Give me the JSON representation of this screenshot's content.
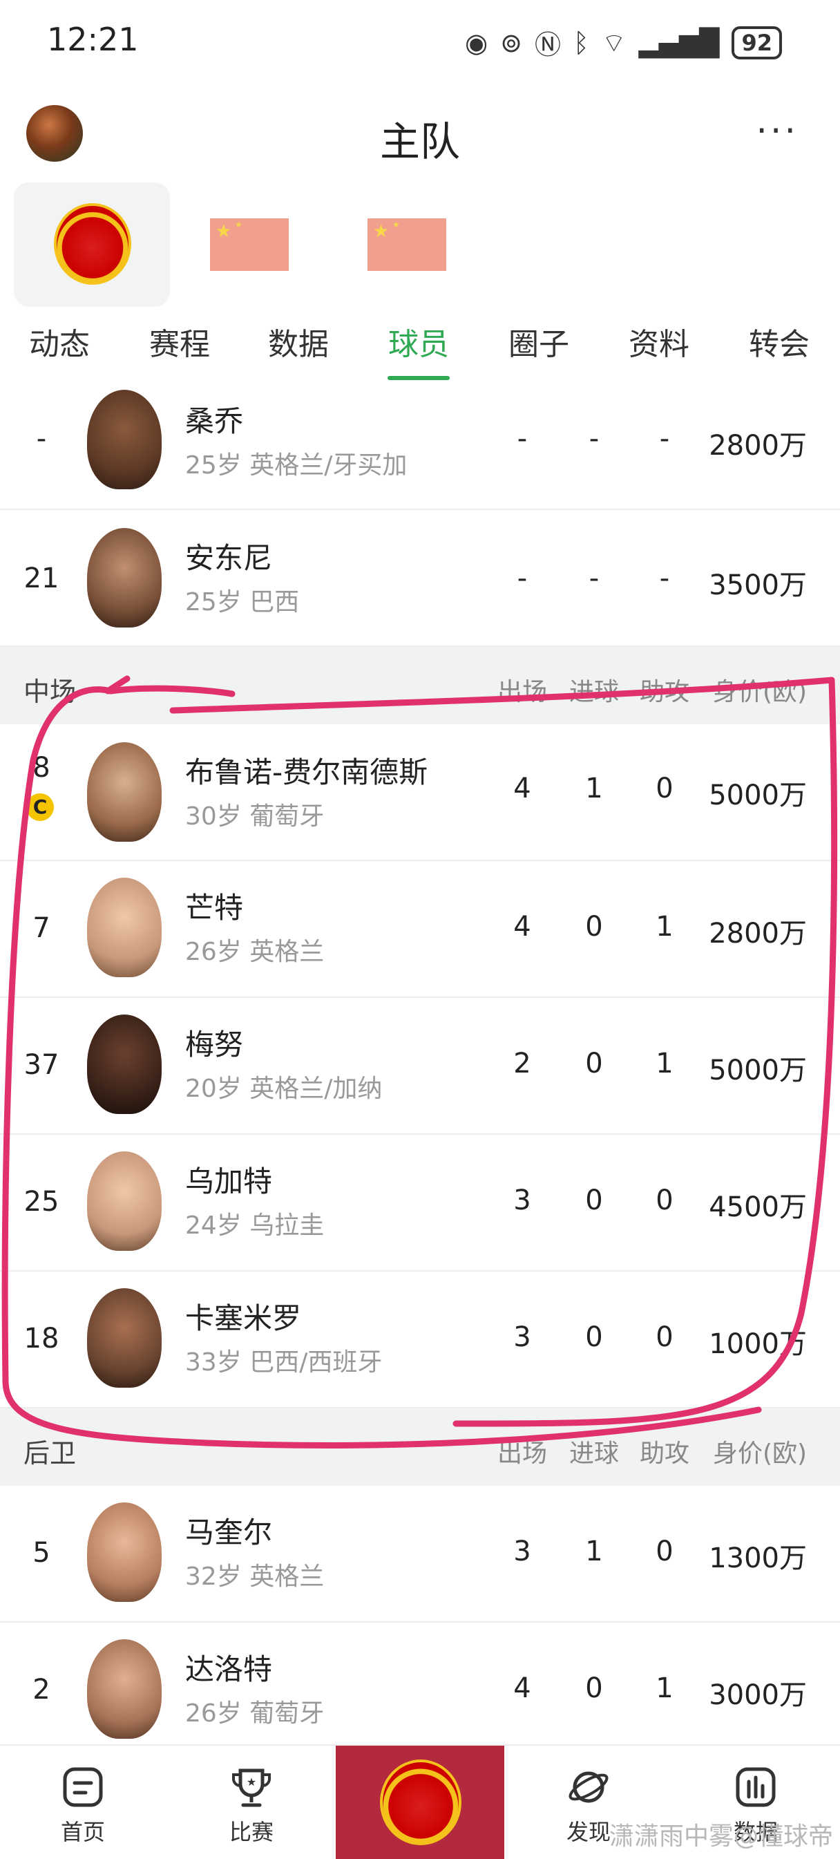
{
  "status": {
    "time": "12:21",
    "battery": "92",
    "icons": [
      "eye-icon",
      "hotspot-icon",
      "nfc-icon",
      "bluetooth-icon",
      "wifi-icon",
      "signal-icon",
      "battery-icon"
    ]
  },
  "header": {
    "title": "主队",
    "more": "···"
  },
  "tabs": [
    "动态",
    "赛程",
    "数据",
    "球员",
    "圈子",
    "资料",
    "转会"
  ],
  "active_tab": "球员",
  "colors": {
    "accent": "#2faa52",
    "brand": "#b32a3f",
    "highlight": "#e0306e"
  },
  "players_top": [
    {
      "num": "-",
      "name": "桑乔",
      "info": "25岁 英格兰/牙买加",
      "apps": "-",
      "goals": "-",
      "assists": "-",
      "value": "2800万"
    },
    {
      "num": "21",
      "name": "安东尼",
      "info": "25岁 巴西",
      "apps": "-",
      "goals": "-",
      "assists": "-",
      "value": "3500万"
    }
  ],
  "midfield": {
    "title": "中场",
    "columns": [
      "出场",
      "进球",
      "助攻",
      "身价(欧)"
    ],
    "players": [
      {
        "num": "8",
        "captain": "C",
        "name": "布鲁诺-费尔南德斯",
        "info": "30岁 葡萄牙",
        "apps": "4",
        "goals": "1",
        "assists": "0",
        "value": "5000万"
      },
      {
        "num": "7",
        "name": "芒特",
        "info": "26岁 英格兰",
        "apps": "4",
        "goals": "0",
        "assists": "1",
        "value": "2800万"
      },
      {
        "num": "37",
        "name": "梅努",
        "info": "20岁 英格兰/加纳",
        "apps": "2",
        "goals": "0",
        "assists": "1",
        "value": "5000万"
      },
      {
        "num": "25",
        "name": "乌加特",
        "info": "24岁 乌拉圭",
        "apps": "3",
        "goals": "0",
        "assists": "0",
        "value": "4500万"
      },
      {
        "num": "18",
        "name": "卡塞米罗",
        "info": "33岁 巴西/西班牙",
        "apps": "3",
        "goals": "0",
        "assists": "0",
        "value": "1000万"
      }
    ]
  },
  "defense": {
    "title": "后卫",
    "columns": [
      "出场",
      "进球",
      "助攻",
      "身价(欧)"
    ],
    "players": [
      {
        "num": "5",
        "name": "马奎尔",
        "info": "32岁 英格兰",
        "apps": "3",
        "goals": "1",
        "assists": "0",
        "value": "1300万"
      },
      {
        "num": "2",
        "name": "达洛特",
        "info": "26岁 葡萄牙",
        "apps": "4",
        "goals": "0",
        "assists": "1",
        "value": "3000万"
      }
    ]
  },
  "nav": [
    "首页",
    "比赛",
    "",
    "发现",
    "数据"
  ],
  "watermark": "潇潇雨中雾@懂球帝"
}
